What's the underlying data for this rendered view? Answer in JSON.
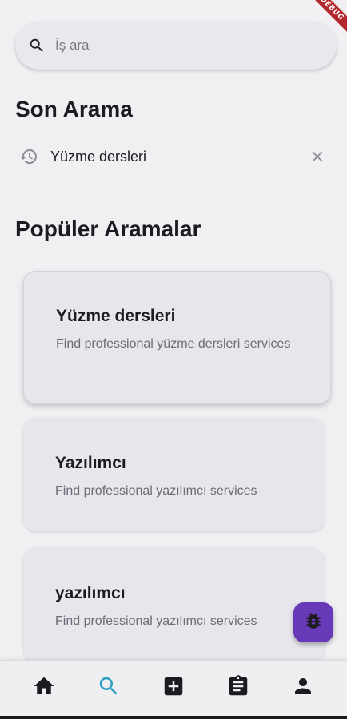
{
  "debug_banner": {
    "label": "DEBUG"
  },
  "search": {
    "placeholder": "İş ara",
    "value": ""
  },
  "recent": {
    "title": "Son Arama",
    "items": [
      {
        "label": "Yüzme dersleri"
      }
    ]
  },
  "popular": {
    "title": "Popüler Aramalar",
    "items": [
      {
        "title": "Yüzme dersleri",
        "description": "Find professional yüzme dersleri services"
      },
      {
        "title": "Yazılımcı",
        "description": "Find professional yazılımcı services"
      },
      {
        "title": "yazılımcı",
        "description": "Find professional yazılımcı services"
      }
    ]
  },
  "nav": {
    "items": [
      {
        "icon": "home-icon",
        "active": false
      },
      {
        "icon": "search-icon",
        "active": true
      },
      {
        "icon": "add-box-icon",
        "active": false
      },
      {
        "icon": "assignment-icon",
        "active": false
      },
      {
        "icon": "person-icon",
        "active": false
      }
    ]
  },
  "colors": {
    "accent": "#2a9fc4",
    "fab": "#673ab7",
    "icon": "#1d1b20",
    "banner": "#b4272c"
  }
}
